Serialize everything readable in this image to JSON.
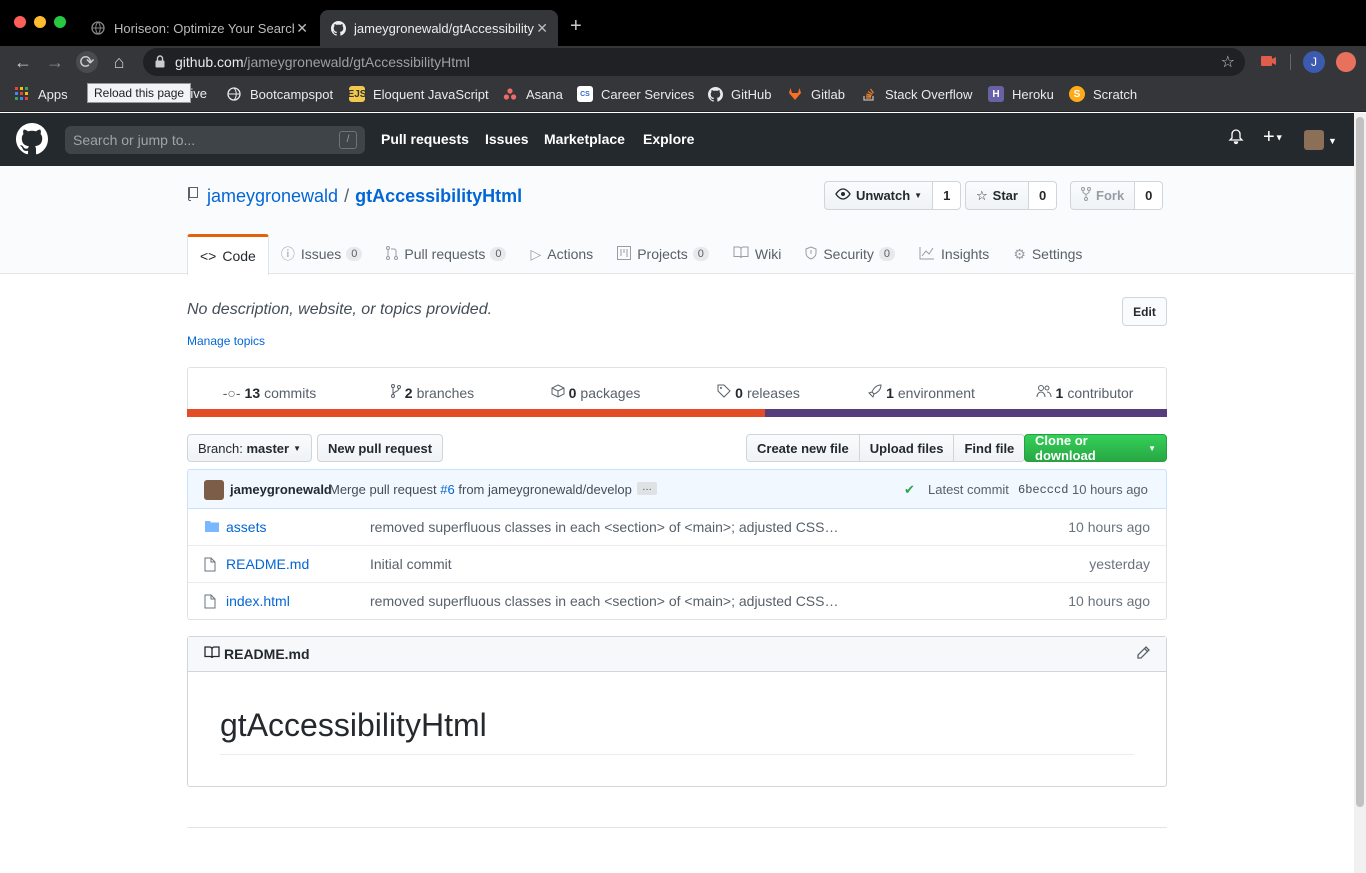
{
  "browser": {
    "tabs": [
      {
        "title": "Horiseon: Optimize Your Search",
        "active": false
      },
      {
        "title": "jameygronewald/gtAccessibility",
        "active": true
      }
    ],
    "url_domain": "github.com",
    "url_path": "/jameygronewald/gtAccessibilityHtml",
    "tooltip": "Reload this page",
    "profile_initial": "J",
    "bookmarks": [
      {
        "label": "Apps",
        "icon": "apps-grid-icon"
      },
      {
        "label": "rive",
        "icon": "drive-icon"
      },
      {
        "label": "Bootcampspot",
        "icon": "globe-icon"
      },
      {
        "label": "Eloquent JavaScript",
        "icon": "ejs-icon"
      },
      {
        "label": "Asana",
        "icon": "asana-icon"
      },
      {
        "label": "Career Services",
        "icon": "career-icon"
      },
      {
        "label": "GitHub",
        "icon": "github-icon"
      },
      {
        "label": "Gitlab",
        "icon": "gitlab-icon"
      },
      {
        "label": "Stack Overflow",
        "icon": "stackoverflow-icon"
      },
      {
        "label": "Heroku",
        "icon": "heroku-icon"
      },
      {
        "label": "Scratch",
        "icon": "scratch-icon"
      }
    ]
  },
  "header": {
    "search_placeholder": "Search or jump to...",
    "slash_hint": "/",
    "nav": [
      "Pull requests",
      "Issues",
      "Marketplace",
      "Explore"
    ]
  },
  "repo": {
    "owner": "jameygronewald",
    "separator": "/",
    "name": "gtAccessibilityHtml",
    "unwatch_label": "Unwatch",
    "watch_count": "1",
    "star_label": "Star",
    "star_count": "0",
    "fork_label": "Fork",
    "fork_count": "0",
    "tabs": [
      {
        "label": "Code",
        "count": ""
      },
      {
        "label": "Issues",
        "count": "0"
      },
      {
        "label": "Pull requests",
        "count": "0"
      },
      {
        "label": "Actions",
        "count": ""
      },
      {
        "label": "Projects",
        "count": "0"
      },
      {
        "label": "Wiki",
        "count": ""
      },
      {
        "label": "Security",
        "count": "0"
      },
      {
        "label": "Insights",
        "count": ""
      },
      {
        "label": "Settings",
        "count": ""
      }
    ],
    "description": "No description, website, or topics provided.",
    "edit_label": "Edit",
    "manage_topics": "Manage topics",
    "summary": [
      {
        "num": "13",
        "label": "commits"
      },
      {
        "num": "2",
        "label": "branches"
      },
      {
        "num": "0",
        "label": "packages"
      },
      {
        "num": "0",
        "label": "releases"
      },
      {
        "num": "1",
        "label": "environment"
      },
      {
        "num": "1",
        "label": "contributor"
      }
    ],
    "language_colors": [
      "#e34c26",
      "#563d7c"
    ],
    "language_fraction": 0.59,
    "branch_label": "Branch:",
    "branch_name": "master",
    "new_pr": "New pull request",
    "create_file": "Create new file",
    "upload_files": "Upload files",
    "find_file": "Find file",
    "clone": "Clone or download",
    "commit": {
      "author": "jameygronewald",
      "message": "Merge pull request",
      "pr": "#6",
      "from": "from jameygronewald/develop",
      "ellipsis": "…",
      "latest_label": "Latest commit",
      "sha": "6becccd",
      "age": "10 hours ago"
    },
    "files": [
      {
        "type": "dir",
        "name": "assets",
        "message": "removed superfluous classes in each <section> of <main>; adjusted CSS…",
        "age": "10 hours ago"
      },
      {
        "type": "file",
        "name": "README.md",
        "message": "Initial commit",
        "age": "yesterday"
      },
      {
        "type": "file",
        "name": "index.html",
        "message": "removed superfluous classes in each <section> of <main>; adjusted CSS…",
        "age": "10 hours ago"
      }
    ],
    "readme_title": "README.md",
    "readme_h1": "gtAccessibilityHtml"
  }
}
